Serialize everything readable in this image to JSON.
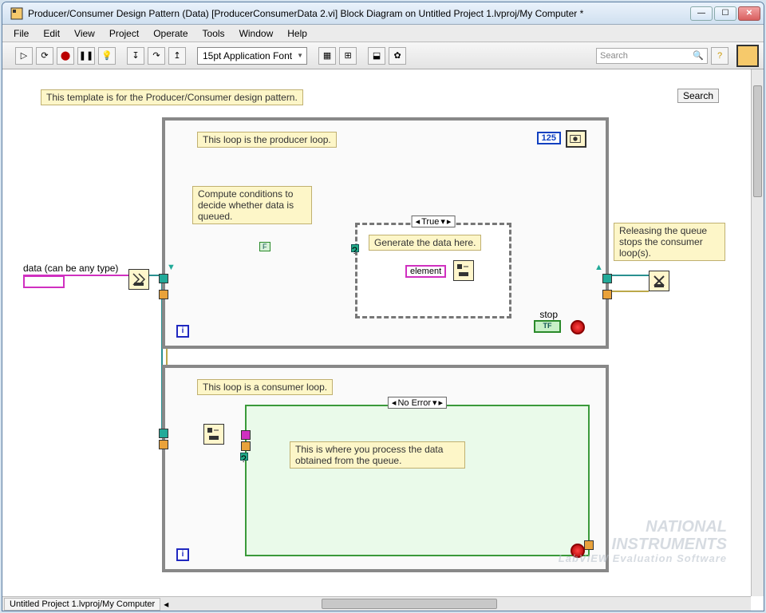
{
  "window": {
    "title": "Producer/Consumer Design Pattern (Data) [ProducerConsumerData 2.vi] Block Diagram on Untitled Project 1.lvproj/My Computer *"
  },
  "menu": {
    "items": [
      "File",
      "Edit",
      "View",
      "Project",
      "Operate",
      "Tools",
      "Window",
      "Help"
    ]
  },
  "toolbar": {
    "font": "15pt Application Font",
    "search_placeholder": "Search"
  },
  "diagram": {
    "template_comment": "This template is for the Producer/Consumer design pattern.",
    "search_button": "Search",
    "data_label": "data (can be any type)",
    "producer": {
      "title_comment": "This loop is the producer loop.",
      "compute_comment": "Compute conditions to decide whether data is queued.",
      "wait_ms": "125",
      "case_selector": "True",
      "generate_comment": "Generate the data here.",
      "element_label": "element",
      "false_const": "F",
      "stop_label": "stop",
      "tf_label": "TF"
    },
    "release_comment": "Releasing the queue stops the consumer loop(s).",
    "consumer": {
      "title_comment": "This loop is a consumer loop.",
      "case_selector": "No Error",
      "process_comment": "This is where you process the data obtained from the queue."
    }
  },
  "breadcrumb": "Untitled Project 1.lvproj/My Computer",
  "watermark": {
    "line1": "NATIONAL",
    "line2": "INSTRUMENTS",
    "line3": "LabVIEW  Evaluation Software"
  },
  "icons": {
    "i": "i"
  }
}
